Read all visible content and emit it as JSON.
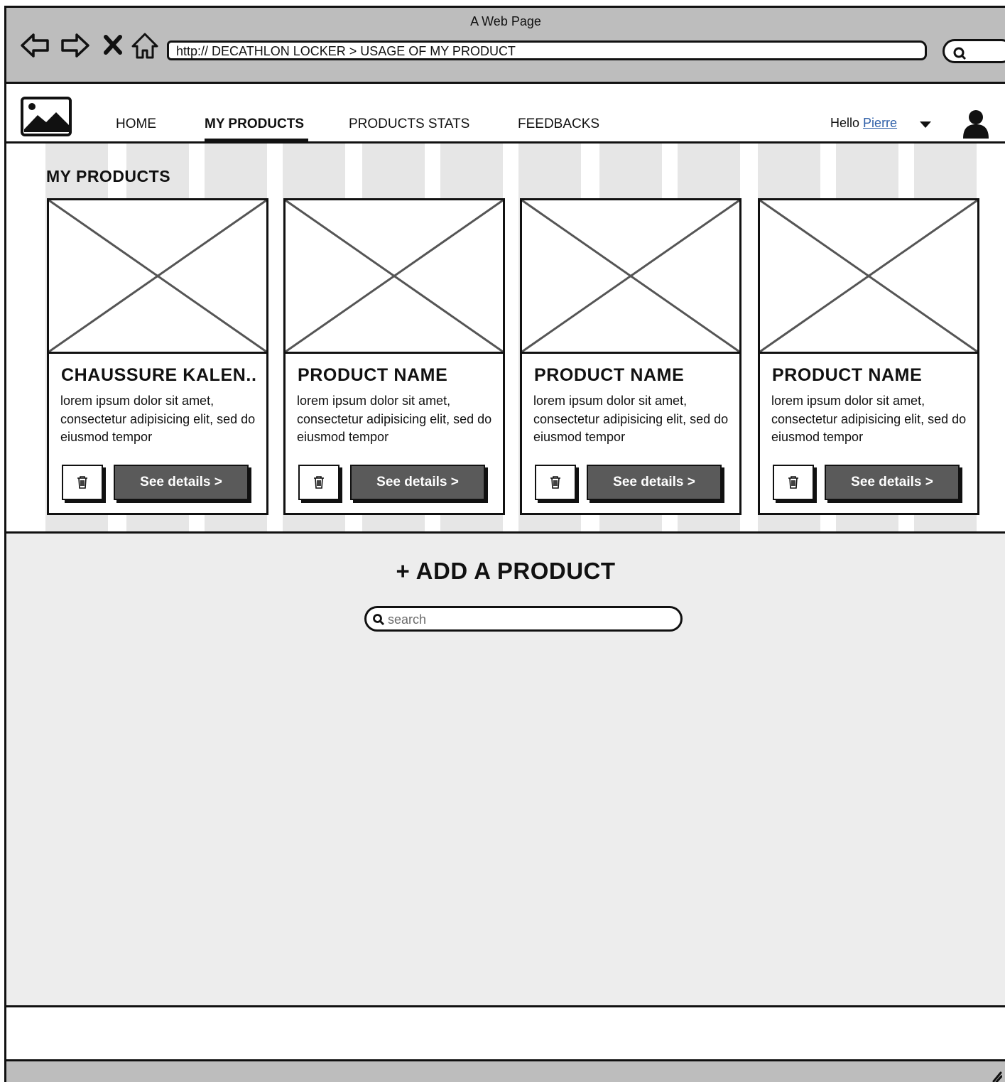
{
  "window": {
    "title": "A Web Page"
  },
  "browser": {
    "url": "http:// DECATHLON LOCKER > USAGE OF MY PRODUCT",
    "icons": [
      "back-arrow-icon",
      "forward-arrow-icon",
      "close-icon",
      "home-icon",
      "search-icon"
    ]
  },
  "nav": {
    "logo": "image-placeholder-icon",
    "links": [
      {
        "label": "HOME"
      },
      {
        "label": "MY PRODUCTS",
        "active": true
      },
      {
        "label": "PRODUCTS STATS"
      },
      {
        "label": "FEEDBACKS"
      }
    ],
    "greeting": "Hello",
    "user_name": "Pierre",
    "avatar": "user-icon"
  },
  "main": {
    "section_title": "MY PRODUCTS",
    "products": [
      {
        "name": "CHAUSSURE KALEN..",
        "description": "lorem ipsum dolor sit amet, consectetur adipisicing elit, sed do eiusmod tempor",
        "details_label": "See details >"
      },
      {
        "name": "PRODUCT NAME",
        "description": "lorem ipsum dolor sit amet, consectetur adipisicing elit, sed do eiusmod tempor",
        "details_label": "See details >"
      },
      {
        "name": "PRODUCT NAME",
        "description": "lorem ipsum dolor sit amet, consectetur adipisicing elit, sed do eiusmod tempor",
        "details_label": "See details >"
      },
      {
        "name": "PRODUCT NAME",
        "description": "lorem ipsum dolor sit amet, consectetur adipisicing elit, sed do eiusmod tempor",
        "details_label": "See details >"
      }
    ]
  },
  "add_product": {
    "title": "+ ADD A PRODUCT",
    "search_placeholder": "search"
  },
  "colors": {
    "window_chrome": "#bdbdbd",
    "panel": "#ededed",
    "button": "#5a5a5a",
    "link": "#2e5fa8"
  }
}
